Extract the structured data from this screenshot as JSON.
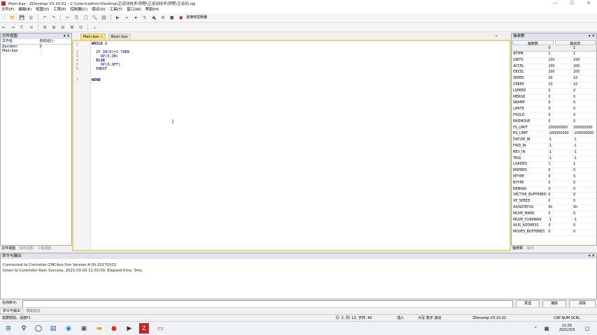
{
  "window": {
    "title": "Main.bas - ZDevelop V3.10.01 - C:\\Users\\admin\\Desktop\\正运动技术\\例程\\正运动技术\\例程\\正运动.zpj",
    "minimize": "—",
    "maximize": "☐",
    "close": "✕"
  },
  "menu": [
    "文件(F)",
    "编辑(E)",
    "视图(V)",
    "工程(P)",
    "控制器(C)",
    "调试(D)",
    "工具(T)",
    "窗口(W)",
    "帮助(H)"
  ],
  "toolbar": {
    "row1": [
      "📄",
      "📂",
      "💾",
      "🖫",
      "↶",
      "↷",
      "✂",
      "⎘",
      "📋",
      "🔍",
      "🖨",
      "▶",
      "⏸",
      "⏹",
      "↻",
      "🔌",
      "⚙",
      "■",
      "●"
    ],
    "connect_label": "连接到控制器",
    "row2": [
      "⇤",
      "⇥",
      "⇱",
      "⇲",
      "≣",
      "⊞",
      "⊟",
      "⊠",
      "⊡",
      "⊥"
    ]
  },
  "left_panel": {
    "title": "文件视图",
    "pin": "▾ ✕",
    "columns": [
      "文件名",
      "自动运行"
    ],
    "files": [
      {
        "name": "Zecidem",
        "auto": "0"
      },
      {
        "name": "Main.bas",
        "auto": "·"
      }
    ],
    "tabs": [
      "文件视图",
      "程序视图",
      "工程视图"
    ]
  },
  "editor": {
    "tabs": [
      {
        "label": "Main.bas",
        "active": true
      },
      {
        "label": "Basic.bas",
        "active": false
      }
    ],
    "lines": [
      {
        "n": "1",
        "text": "WHILE 1"
      },
      {
        "n": "2",
        "text": "  IF IN(0)=1 THEN"
      },
      {
        "n": "3",
        "text": "    OP(0,ON)"
      },
      {
        "n": "4",
        "text": "  ELSE"
      },
      {
        "n": "5",
        "text": "    OP(0,OFF)"
      },
      {
        "n": "6",
        "text": "  ENDIF"
      },
      {
        "n": "7",
        "text": "WEND"
      }
    ]
  },
  "right_panel": {
    "title": "轴参数",
    "pin": "▾ ✕",
    "tabs": [
      "轴参数",
      "轴状态"
    ],
    "columns": [
      "",
      "0",
      "1"
    ],
    "rows": [
      [
        "ATYPE",
        "1",
        "1"
      ],
      [
        "UNITS",
        "100",
        "100"
      ],
      [
        "ACCEL",
        "200",
        "200"
      ],
      [
        "DECEL",
        "200",
        "200"
      ],
      [
        "SPEED",
        "20",
        "10"
      ],
      [
        "CREEP",
        "10",
        "10"
      ],
      [
        "LSPEED",
        "0",
        "0"
      ],
      [
        "MERGE",
        "0",
        "0"
      ],
      [
        "SRAMP",
        "0",
        "0"
      ],
      [
        "LIMITS",
        "0",
        "0"
      ],
      [
        "FHOLD",
        "0",
        "0"
      ],
      [
        "ENDMOVE",
        "0",
        "0"
      ],
      [
        "FS_LIMIT",
        "200000000",
        "200000000"
      ],
      [
        "RS_LIMIT",
        "-200000000",
        "-200000000"
      ],
      [
        "DATUM_IN",
        "-1",
        "-1"
      ],
      [
        "FWD_IN",
        "-1",
        "-1"
      ],
      [
        "REV_IN",
        "-1",
        "-1"
      ],
      [
        "TRIG",
        "-1",
        "-1"
      ],
      [
        "LOADED",
        "1",
        "1"
      ],
      [
        "MSPEED",
        "0",
        "0"
      ],
      [
        "MTYPE",
        "0",
        "0"
      ],
      [
        "NTYPE",
        "0",
        "0"
      ],
      [
        "REMAIN",
        "0",
        "0"
      ],
      [
        "VECTOR_BUFFERED",
        "0",
        "0"
      ],
      [
        "VP_SPEED",
        "0",
        "0"
      ],
      [
        "AXISSTATUS",
        "0h",
        "0h"
      ],
      [
        "MOVE_MARK",
        "0",
        "0"
      ],
      [
        "MOVE_CURMARK",
        "-1",
        "-1"
      ],
      [
        "AXIS_ADDRESS",
        "0",
        "0"
      ],
      [
        "MOVES_BUFFERED",
        "0",
        "0"
      ]
    ],
    "bottom_tabs": [
      "轴参数",
      "输出"
    ]
  },
  "output": {
    "title": "命令与输出",
    "lines": [
      "Connected to Controller:ZMC4xx-Sim Version:4.00-20170102.",
      "Down to Controller Ram Success, 2021-03-03 11:55:09, Elapsed time: 3ms."
    ]
  },
  "command": {
    "label": "在线命令:",
    "send": "发送",
    "capture": "捕获",
    "clear": "清除"
  },
  "bottom_tabs": [
    "命令与输出",
    "帮助信息"
  ],
  "status": {
    "left": "需要帮助，请按F1",
    "pos": "行: 3, 列: 12, 字符: 40",
    "mode": "插入",
    "zoom": "大写 数字 滚动",
    "build": "ZDevelop V3.10.01",
    "caps": "CAP NUM SCRL"
  },
  "taskbar": {
    "start": "⊞",
    "search": "⚲",
    "taskview": "◯",
    "time": "11:55",
    "date": "2021/3/3"
  }
}
